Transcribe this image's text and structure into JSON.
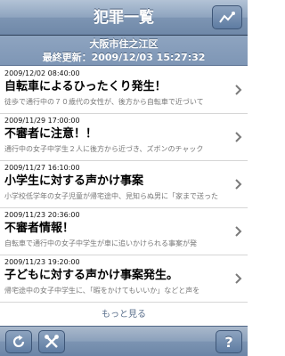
{
  "nav": {
    "title": "犯罪一覧",
    "action_icon": "map-pin-icon"
  },
  "header": {
    "area": "大阪市住之江区",
    "updated_label": "最終更新：",
    "updated_value": "2009/12/03 15:27:32"
  },
  "items": [
    {
      "date": "2009/12/02 08:40:00",
      "title": "自転車によるひったくり発生！",
      "desc": "徒歩で通行中の７０歳代の女性が、後方から自転車で近づいて"
    },
    {
      "date": "2009/11/29 17:00:00",
      "title": "不審者に注意！！",
      "desc": "通行中の女子中学生２人に後方から近づき、ズボンのチャック"
    },
    {
      "date": "2009/11/27 16:10:00",
      "title": "小学生に対する声かけ事案",
      "desc": "小学校低学年の女子児童が帰宅途中、見知らぬ男に「家まで送った"
    },
    {
      "date": "2009/11/23 20:36:00",
      "title": "不審者情報！",
      "desc": "自転車で通行中の女子中学生が車に追いかけられる事案が発"
    },
    {
      "date": "2009/11/23 19:20:00",
      "title": "子どもに対する声かけ事案発生。",
      "desc": "帰宅途中の女子中学生に、「暇をかけてもいいか」などと声を"
    }
  ],
  "more_label": "もっと見る",
  "toolbar": {
    "refresh_icon": "refresh-icon",
    "tools_icon": "tools-icon",
    "help_label": "?"
  },
  "colors": {
    "nav": "#7d95b3",
    "subheader": "#8ea4c0",
    "chevron": "#7a7a7a"
  }
}
